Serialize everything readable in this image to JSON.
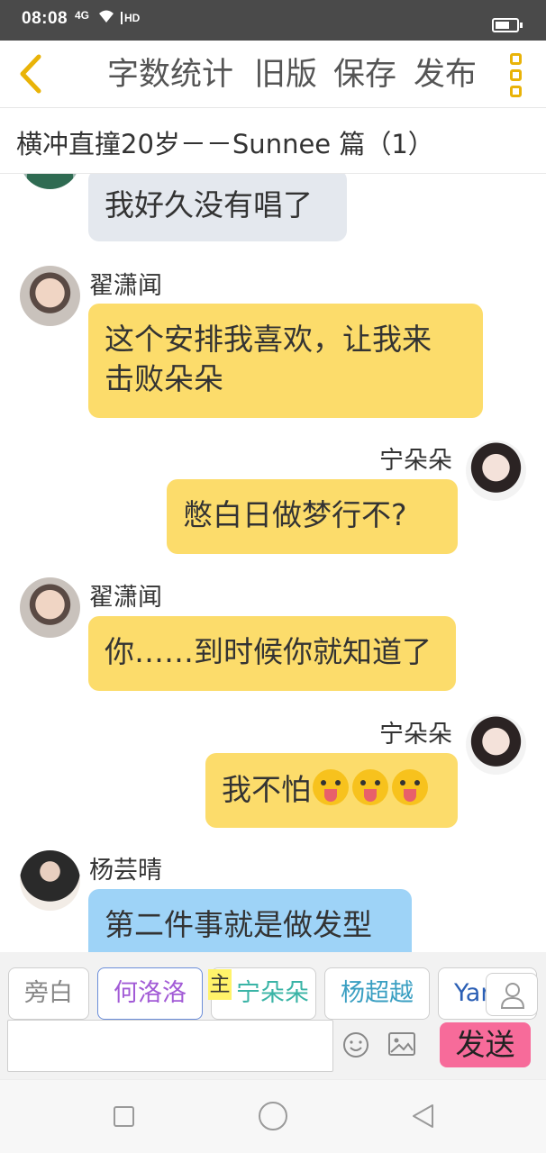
{
  "status_bar": {
    "time": "08:08",
    "network": "4G",
    "wifi_icon": "wifi-icon",
    "hd": "HD",
    "battery_icon": "battery-icon"
  },
  "toolbar": {
    "back_icon": "chevron-left-icon",
    "word_count": "字数统计",
    "old_version": "旧版",
    "save": "保存",
    "publish": "发布",
    "more_icon": "more-vertical-icon",
    "accent_color": "#e9b308"
  },
  "story": {
    "title": "横冲直撞20岁－－Sunnee 篇（1）"
  },
  "messages": [
    {
      "side": "left",
      "speaker": "",
      "text": "我好久没有唱了",
      "color": "gray"
    },
    {
      "side": "left",
      "speaker": "翟潇闻",
      "text": "这个安排我喜欢，让我来击败朵朵",
      "line1": "这个安排我喜欢，让我来",
      "line2": "击败朵朵",
      "color": "yellow"
    },
    {
      "side": "right",
      "speaker": "宁朵朵",
      "text": "憋白日做梦行不?",
      "color": "yellow"
    },
    {
      "side": "left",
      "speaker": "翟潇闻",
      "text": "你……到时候你就知道了",
      "color": "yellow"
    },
    {
      "side": "right",
      "speaker": "宁朵朵",
      "text": "我不怕",
      "emoji": "tongue-out-emoji",
      "emoji_count": 3,
      "color": "yellow"
    },
    {
      "side": "left",
      "speaker": "杨芸晴",
      "text": "第二件事就是做发型",
      "color": "blue"
    }
  ],
  "characters": [
    {
      "name": "旁白",
      "color": "#888888"
    },
    {
      "name": "何洛洛",
      "color": "#a25bd6",
      "active": true
    },
    {
      "name": "宁朵朵",
      "color": "#3ab4a6",
      "tag": "主"
    },
    {
      "name": "杨超越",
      "color": "#3a9fc2"
    },
    {
      "name": "Yan",
      "color": "#2b5fb5"
    }
  ],
  "composer": {
    "input_value": "",
    "emoji_icon": "smiley-icon",
    "image_icon": "image-icon",
    "user_icon": "user-icon",
    "send_label": "发送",
    "send_color": "#f76b9a"
  },
  "nav": {
    "recent_icon": "square-icon",
    "home_icon": "circle-icon",
    "back_icon": "triangle-back-icon"
  }
}
